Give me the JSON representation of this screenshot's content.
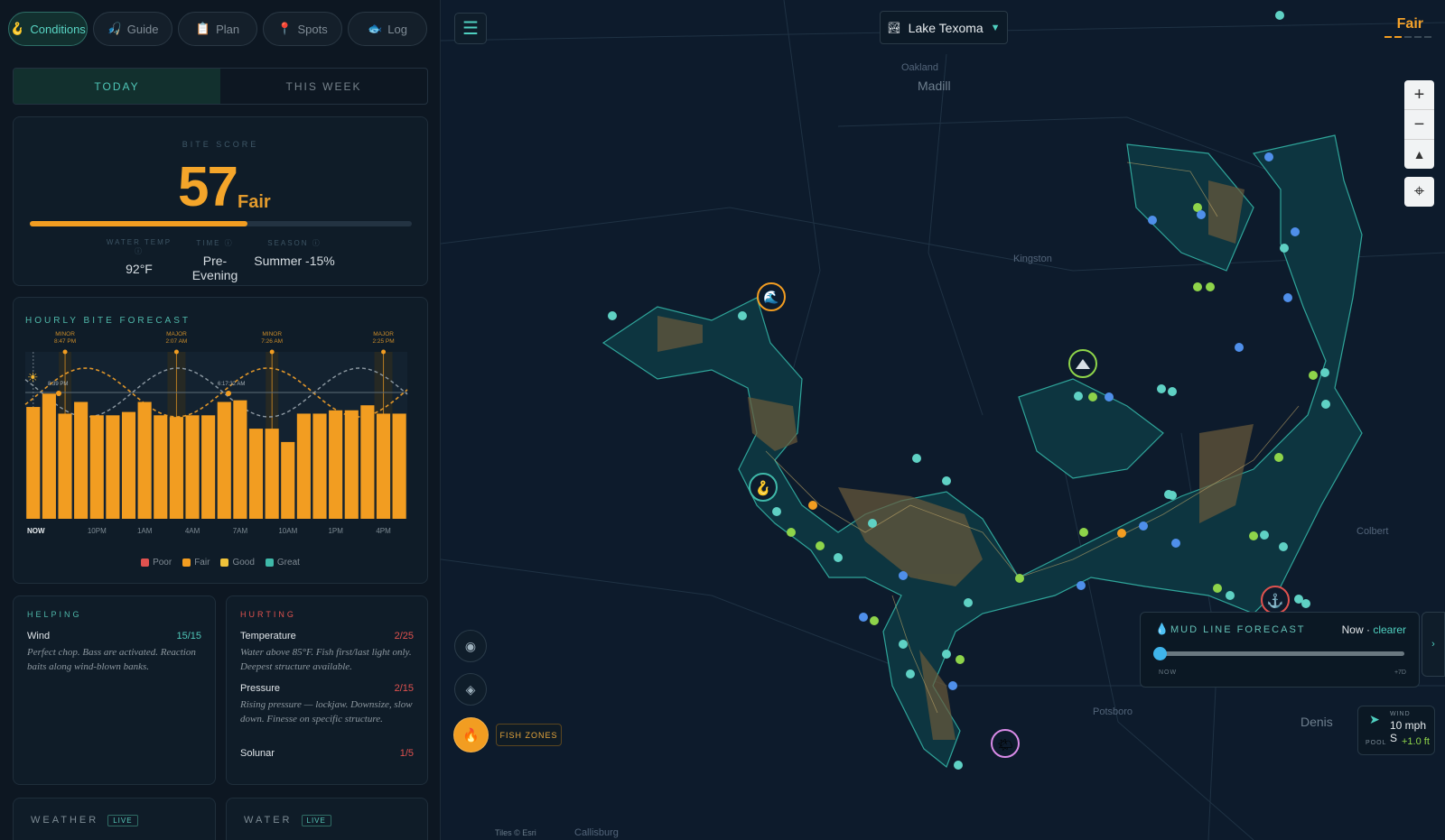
{
  "tabs": [
    {
      "label": "Conditions",
      "icon": "lure-icon",
      "active": true
    },
    {
      "label": "Guide",
      "icon": "fisherman-icon",
      "active": false
    },
    {
      "label": "Plan",
      "icon": "clipboard-icon",
      "active": false
    },
    {
      "label": "Spots",
      "icon": "pin-icon",
      "active": false
    },
    {
      "label": "Log",
      "icon": "fish-icon",
      "active": false
    }
  ],
  "day_tabs": {
    "today": "TODAY",
    "week": "THIS WEEK"
  },
  "bite": {
    "label": "BITE SCORE",
    "score": "57",
    "rating": "Fair",
    "progress": 0.57,
    "water_temp_label": "WATER TEMP ⓘ",
    "water_temp": "92°F",
    "time_label": "TIME ⓘ",
    "time": "Pre-Evening",
    "season_label": "SEASON ⓘ",
    "season": "Summer -15%"
  },
  "hourly": {
    "label": "HOURLY BITE FORECAST",
    "x_labels": [
      "NOW",
      "10PM",
      "1AM",
      "4AM",
      "7AM",
      "10AM",
      "1PM",
      "4PM"
    ],
    "legend": [
      "Poor",
      "Fair",
      "Good",
      "Great"
    ],
    "legend_colors": [
      "#e0524f",
      "#f29d21",
      "#efc23a",
      "#3fb9a9"
    ]
  },
  "chart_data": {
    "type": "bar",
    "title": "HOURLY BITE FORECAST",
    "x": [
      "NOW",
      "",
      "",
      "",
      "10PM",
      "",
      "",
      "1AM",
      "",
      "",
      "4AM",
      "",
      "",
      "7AM",
      "",
      "",
      "10AM",
      "",
      "",
      "1PM",
      "",
      "",
      "4PM",
      ""
    ],
    "values": [
      67,
      75,
      63,
      70,
      62,
      62,
      64,
      70,
      62,
      61,
      62,
      62,
      70,
      71,
      54,
      54,
      46,
      63,
      63,
      65,
      65,
      68,
      63,
      63
    ],
    "solunar": [
      {
        "type": "MINOR",
        "time": "8:47 PM"
      },
      {
        "type": "MAJOR",
        "time": "2:07 AM"
      },
      {
        "type": "MINOR",
        "time": "7:26 AM"
      },
      {
        "type": "MAJOR",
        "time": "2:25 PM"
      }
    ],
    "moon_labels": [
      "8:39 PM",
      "6:17:32 AM"
    ],
    "legend": [
      "Poor",
      "Fair",
      "Good",
      "Great"
    ],
    "legend_position": "bottom"
  },
  "helping": {
    "label": "HELPING",
    "items": [
      {
        "name": "Wind",
        "score": "15/15",
        "desc": "Perfect chop. Bass are activated. Reaction baits along wind-blown banks."
      }
    ]
  },
  "hurting": {
    "label": "HURTING",
    "items": [
      {
        "name": "Temperature",
        "score": "2/25",
        "desc": "Water above 85°F. Fish first/last light only. Deepest structure available."
      },
      {
        "name": "Pressure",
        "score": "2/15",
        "desc": "Rising pressure — lockjaw. Downsize, slow down. Finesse on specific structure."
      },
      {
        "name": "Solunar",
        "score": "1/5",
        "desc": ""
      }
    ]
  },
  "weather": {
    "label": "WEATHER",
    "live": "LIVE"
  },
  "water": {
    "label": "WATER",
    "live": "LIVE"
  },
  "map": {
    "lake": "Lake Texoma",
    "rating": "Fair",
    "towns": [
      "Oakland",
      "Madill",
      "Kingston",
      "Potsboro",
      "Colbert",
      "Denis",
      "Callisburg"
    ],
    "attribution": "Tiles © Esri",
    "fish_zones": "FISH ZONES",
    "zoom_in": "+",
    "zoom_out": "−"
  },
  "mud": {
    "label": "MUD LINE FORECAST",
    "now": "Now",
    "status": "clearer",
    "start": "NOW",
    "end": "+7D",
    "position": 0
  },
  "wind": {
    "label": "WIND",
    "value": "10 mph S",
    "pool_label": "POOL",
    "pool": "+1.0 ft"
  },
  "colors": {
    "accent": "#f29d21",
    "teal": "#3fb9a9",
    "bg": "#0d1722"
  }
}
